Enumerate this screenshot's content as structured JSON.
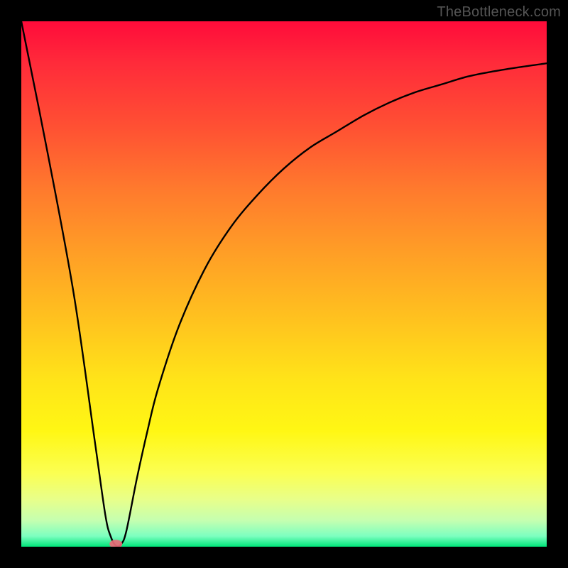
{
  "attribution": "TheBottleneck.com",
  "chart_data": {
    "type": "line",
    "title": "",
    "xlabel": "",
    "ylabel": "",
    "xlim": [
      0,
      100
    ],
    "ylim": [
      0,
      100
    ],
    "x": [
      0,
      5,
      10,
      14,
      16,
      17,
      18,
      19,
      20,
      22,
      24,
      26,
      30,
      35,
      40,
      45,
      50,
      55,
      60,
      65,
      70,
      75,
      80,
      85,
      90,
      95,
      100
    ],
    "values": [
      100,
      75,
      48,
      20,
      6,
      2,
      0.2,
      0.5,
      3,
      13,
      22,
      30,
      42,
      53,
      61,
      67,
      72,
      76,
      79,
      82,
      84.5,
      86.5,
      88,
      89.5,
      90.5,
      91.3,
      92
    ],
    "marker": {
      "x": 18,
      "y": 0.5
    },
    "background_gradient": {
      "stops": [
        {
          "pos": 0,
          "color": "#ff0b3a"
        },
        {
          "pos": 8,
          "color": "#ff2b3a"
        },
        {
          "pos": 20,
          "color": "#ff5033"
        },
        {
          "pos": 32,
          "color": "#ff7a2d"
        },
        {
          "pos": 44,
          "color": "#ff9e26"
        },
        {
          "pos": 56,
          "color": "#ffc01f"
        },
        {
          "pos": 68,
          "color": "#ffe319"
        },
        {
          "pos": 78,
          "color": "#fff714"
        },
        {
          "pos": 86,
          "color": "#fbff52"
        },
        {
          "pos": 91,
          "color": "#e8ff8a"
        },
        {
          "pos": 95,
          "color": "#c5ffb0"
        },
        {
          "pos": 98,
          "color": "#7cffc0"
        },
        {
          "pos": 100,
          "color": "#00e57a"
        }
      ]
    }
  }
}
